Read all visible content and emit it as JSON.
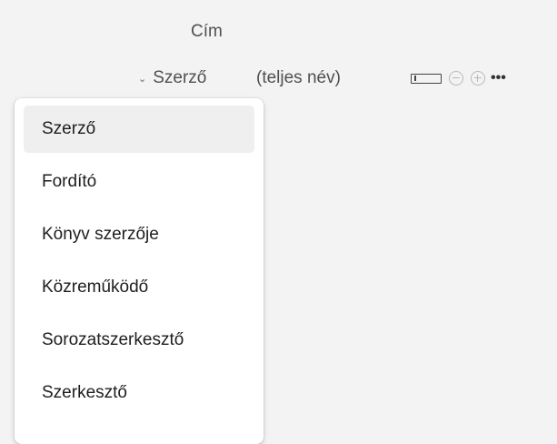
{
  "fields": {
    "title_label": "Cím",
    "role_selected": "Szerző",
    "name_hint": "(teljes név)"
  },
  "toolbar": {
    "more_label": "•••"
  },
  "menu": {
    "items": [
      {
        "label": "Szerző",
        "selected": true
      },
      {
        "label": "Fordító",
        "selected": false
      },
      {
        "label": "Könyv szerzője",
        "selected": false
      },
      {
        "label": "Közreműködő",
        "selected": false
      },
      {
        "label": "Sorozatszerkesztő",
        "selected": false
      },
      {
        "label": "Szerkesztő",
        "selected": false
      }
    ]
  },
  "colors": {
    "background": "#f3f3f3",
    "menu_background": "#ffffff",
    "selected_item": "#efefef"
  },
  "icons": {
    "chevron": "chevron-down-icon",
    "field_box": "field-box-icon",
    "remove": "remove-circle-icon",
    "add": "add-circle-icon",
    "more": "more-icon"
  }
}
